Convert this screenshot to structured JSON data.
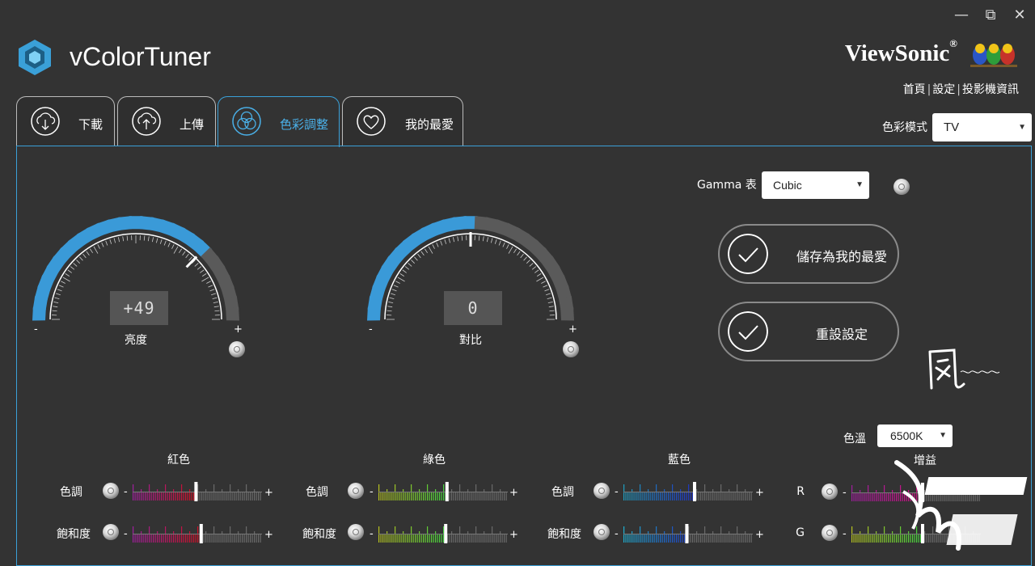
{
  "app": {
    "title": "vColorTuner",
    "brand": "ViewSonic",
    "brand_mark": "®"
  },
  "window": {
    "minimize": "—",
    "restore": "⧉",
    "close": "✕"
  },
  "toplinks": [
    "首頁",
    "設定",
    "投影機資訊"
  ],
  "tabs": [
    {
      "label": "下載",
      "icon": "download-cloud-icon"
    },
    {
      "label": "上傳",
      "icon": "upload-cloud-icon"
    },
    {
      "label": "色彩調整",
      "icon": "color-circles-icon",
      "active": true
    },
    {
      "label": "我的最愛",
      "icon": "heart-icon"
    }
  ],
  "color_mode": {
    "label": "色彩模式",
    "value": "TV"
  },
  "gamma": {
    "label": "Gamma 表",
    "value": "Cubic"
  },
  "brightness": {
    "label": "亮度",
    "display": "+49",
    "minus": "-",
    "plus": "+",
    "level": 49
  },
  "contrast": {
    "label": "對比",
    "display": "0",
    "minus": "-",
    "plus": "+",
    "level": 0
  },
  "buttons": {
    "save": "儲存為我的最愛",
    "reset": "重設設定"
  },
  "color_temp": {
    "label": "色溫",
    "value": "6500K"
  },
  "groups": {
    "red": {
      "title": "紅色",
      "hue_label": "色調",
      "sat_label": "飽和度",
      "hue": 0.49,
      "sat": 0.53
    },
    "green": {
      "title": "綠色",
      "hue_label": "色調",
      "sat_label": "飽和度",
      "hue": 0.53,
      "sat": 0.52
    },
    "blue": {
      "title": "藍色",
      "hue_label": "色調",
      "sat_label": "飽和度",
      "hue": 0.55,
      "sat": 0.49
    },
    "gain": {
      "title": "增益",
      "r_label": "R",
      "g_label": "G",
      "r": 0.55,
      "g": 0.55
    }
  },
  "slider_minus": "-",
  "slider_plus": "+",
  "colors": {
    "accent": "#3aa0d8",
    "background": "#333333"
  }
}
